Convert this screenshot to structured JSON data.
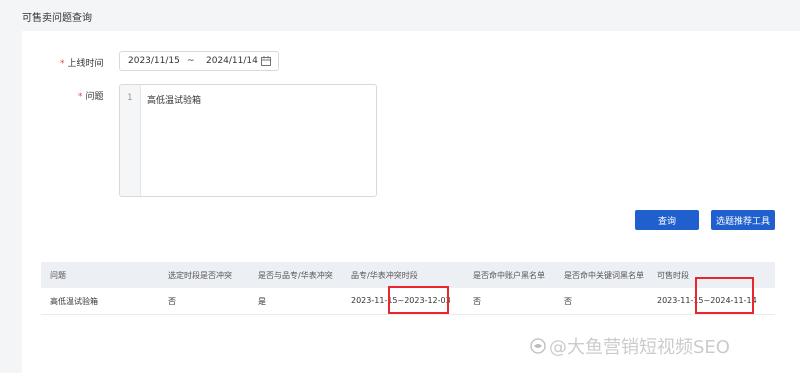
{
  "page": {
    "title": "可售卖问题查询"
  },
  "form": {
    "date_label": "上线时间",
    "date_start": "2023/11/15",
    "date_sep": "~",
    "date_end": "2024/11/14",
    "question_label": "问题",
    "line_number": "1",
    "question_text": "高低温试验箱"
  },
  "buttons": {
    "query": "查询",
    "tools": "选题推荐工具"
  },
  "table": {
    "headers": [
      "问题",
      "选定时段是否冲突",
      "是否与品专/华表冲突",
      "品专/华表冲突时段",
      "是否命中账户黑名单",
      "是否命中关键词黑名单",
      "可售时段"
    ],
    "rows": [
      [
        "高低温试验箱",
        "否",
        "是",
        "2023-11-15~2023-12-03",
        "否",
        "否",
        "2023-11-15~2024-11-14"
      ]
    ]
  },
  "watermark": {
    "text": "@大鱼营销短视频SEO"
  },
  "colors": {
    "primary": "#1f5fce",
    "highlight": "#e8262b",
    "required": "#e54545"
  }
}
